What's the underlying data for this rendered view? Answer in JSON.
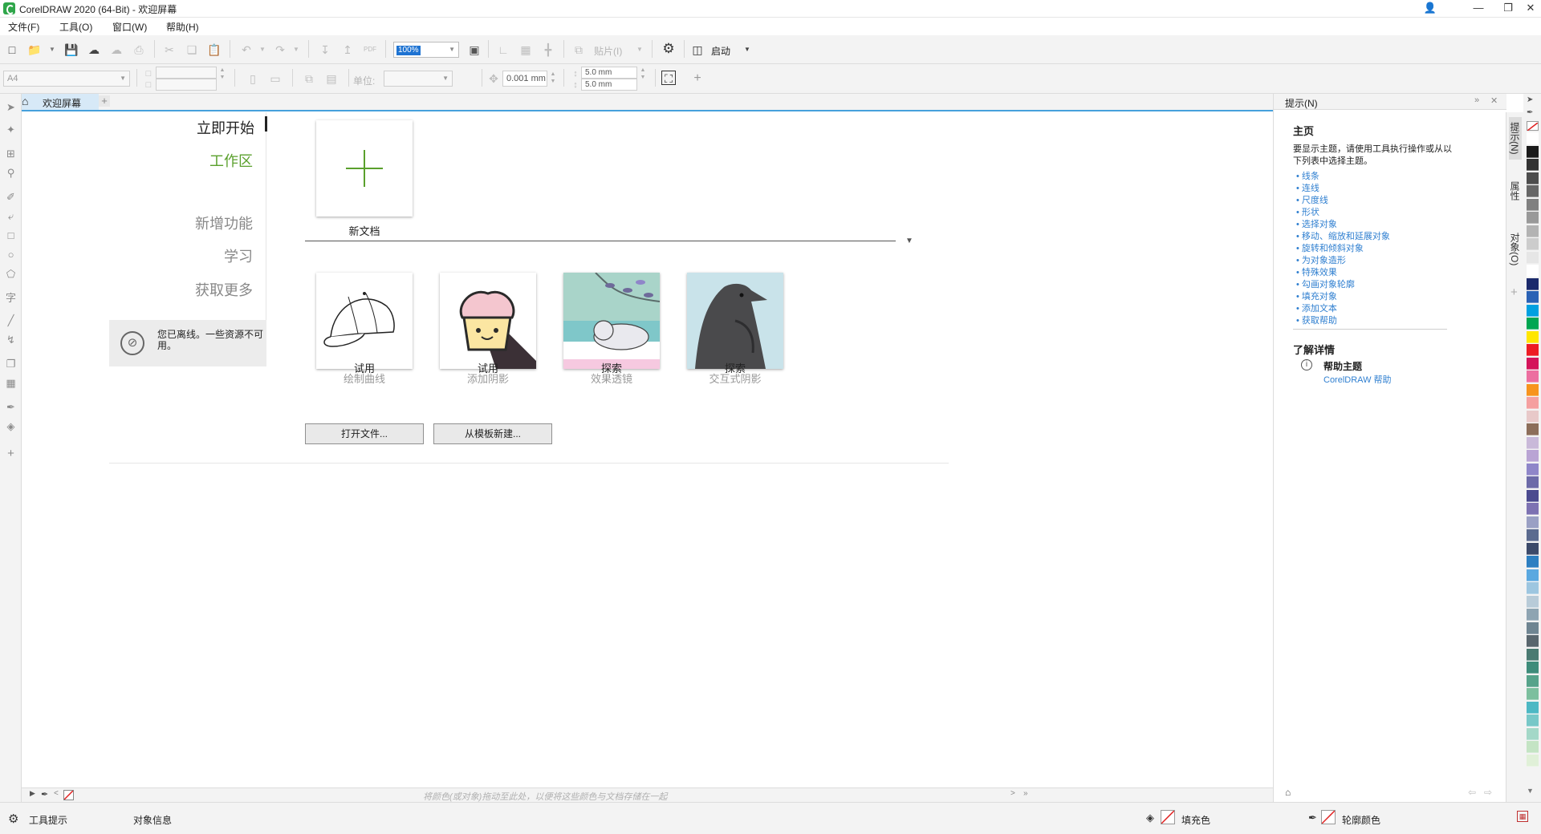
{
  "window": {
    "title": "CorelDRAW 2020 (64-Bit) - 欢迎屏幕",
    "controls": [
      "user-icon",
      "minimize-icon",
      "restore-icon",
      "close-icon"
    ]
  },
  "menu": {
    "items": [
      "文件(F)",
      "工具(O)",
      "窗口(W)",
      "帮助(H)"
    ]
  },
  "toolbar": {
    "zoom_value": "100%",
    "paste_label": "贴片(I)",
    "launch_label": "启动",
    "page_size": "A4",
    "units_label": "单位:",
    "nudge_value": "0.001 mm",
    "dup_x": "5.0 mm",
    "dup_y": "5.0 mm"
  },
  "tabs": {
    "home_tab_label": "欢迎屏幕"
  },
  "welcome": {
    "nav": {
      "start": "立即开始",
      "workspace": "工作区",
      "whats_new": "新增功能",
      "learn": "学习",
      "get_more": "获取更多"
    },
    "offline_text": "您已离线。一些资源不可用。",
    "new_document_label": "新文档",
    "cards": [
      {
        "title": "试用",
        "subtitle": "绘制曲线",
        "image": "baseball-cap"
      },
      {
        "title": "试用",
        "subtitle": "添加阴影",
        "image": "cupcake"
      },
      {
        "title": "探索",
        "subtitle": "效果透镜",
        "image": "sleeping-cat"
      },
      {
        "title": "探索",
        "subtitle": "交互式阴影",
        "image": "raven"
      }
    ],
    "open_file_button": "打开文件...",
    "new_from_template_button": "从模板新建..."
  },
  "doc_status": {
    "drag_hint": "将颜色(或对象)拖动至此处，以便将这些颜色与文档存储在一起"
  },
  "hints_panel": {
    "panel_title": "提示(N)",
    "home_heading": "主页",
    "intro": "要显示主题，请使用工具执行操作或从以下列表中选择主题。",
    "topics": [
      "线条",
      "连线",
      "尺度线",
      "形状",
      "选择对象",
      "移动、缩放和延展对象",
      "旋转和倾斜对象",
      "为对象造形",
      "特殊效果",
      "勾画对象轮廓",
      "填充对象",
      "添加文本",
      "获取帮助"
    ],
    "learn_more_heading": "了解详情",
    "help_topic_title": "帮助主题",
    "help_topic_link": "CorelDRAW 帮助"
  },
  "side_tabs": [
    "提示(N)",
    "属性",
    "对象(O)"
  ],
  "palette": {
    "colors": [
      "#ffffff",
      "#1a1a1a",
      "#333333",
      "#4d4d4d",
      "#666666",
      "#808080",
      "#999999",
      "#b3b3b3",
      "#cccccc",
      "#e6e6e6",
      "#ffffff",
      "#1b2a6b",
      "#2a62b5",
      "#00a0e0",
      "#00a651",
      "#ffe600",
      "#ed1c24",
      "#d4145a",
      "#ec6fa0",
      "#f7941d",
      "#f5a0a0",
      "#e8c9c9",
      "#8c6e5a",
      "#c9b9d9",
      "#b9a4d4",
      "#8f86c9",
      "#6c6aa8",
      "#4b4a8f",
      "#7d72b2",
      "#9aa0c4",
      "#5b6b8f",
      "#3c4a6a",
      "#2d7fc1",
      "#5aa8e0",
      "#9dc6e0",
      "#b8cbd8",
      "#8ea4b2",
      "#6f8592",
      "#59666e",
      "#4a7a72",
      "#3e8c7a",
      "#56a38a",
      "#7cbf9e",
      "#4db8c4",
      "#78c8c8",
      "#a4d8c8",
      "#c4e4c4",
      "#e0f0d8"
    ]
  },
  "statusbar": {
    "tool_hint": "工具提示",
    "object_info": "对象信息",
    "fill_label": "填充色",
    "outline_label": "轮廓颜色"
  }
}
